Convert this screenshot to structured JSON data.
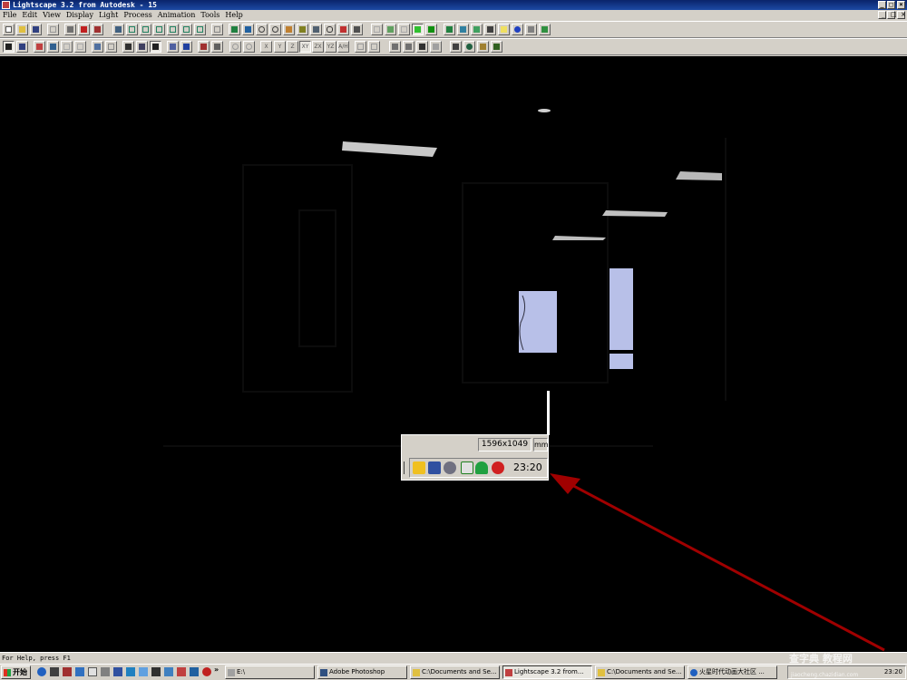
{
  "window": {
    "title": "Lightscape 3.2 from Autodesk - 15",
    "minimize_glyph": "_",
    "maximize_glyph": "□",
    "close_glyph": "×"
  },
  "menu": {
    "items": [
      "File",
      "Edit",
      "View",
      "Display",
      "Light",
      "Process",
      "Animation",
      "Tools",
      "Help"
    ]
  },
  "toolbar2": {
    "axis_labels": [
      "X",
      "Y",
      "Z",
      "XY",
      "ZX",
      "YZ",
      "A/H"
    ]
  },
  "status": {
    "help_text": "For Help, press F1"
  },
  "popup": {
    "resolution": "1596x1049",
    "unit": "mm",
    "time": "23:20"
  },
  "taskbar": {
    "start_label": "开始",
    "tasks": [
      {
        "label": "E:\\"
      },
      {
        "label": "Adobe Photoshop"
      },
      {
        "label": "C:\\Documents and Se..."
      },
      {
        "label": "Lightscape 3.2 from..."
      },
      {
        "label": "C:\\Documents and Se..."
      },
      {
        "label": "火星时代动画大社区 ..."
      }
    ],
    "clock": "23:20",
    "chevron": "»"
  },
  "watermark": {
    "text": "查字典 教程网",
    "url": "jiaocheng.chazidian.com"
  },
  "colors": {
    "accent_arrow": "#a00000",
    "title_bar": "#0a246a",
    "viewport_bg": "#000000",
    "window_panel": "#b8c0e8"
  }
}
